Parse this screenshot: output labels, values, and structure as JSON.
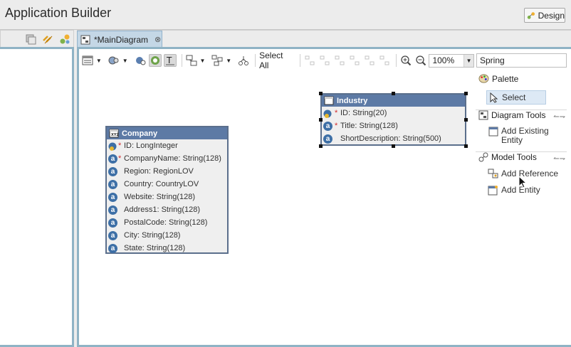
{
  "app": {
    "title": "Application Builder"
  },
  "header": {
    "design_label": "Design"
  },
  "tabs": [
    {
      "label": "*MainDiagram",
      "close_icon": "close-icon"
    }
  ],
  "toolbar": {
    "select_all_label": "Select All",
    "zoom_value": "100%",
    "profile_value": "Spring"
  },
  "palette": {
    "title": "Palette",
    "select_label": "Select",
    "sections": [
      {
        "title": "Diagram Tools",
        "items": [
          {
            "label": "Add Existing Entity",
            "label_line1": "Add Existing",
            "label_line2": "Entity"
          }
        ]
      },
      {
        "title": "Model Tools",
        "items": [
          {
            "label": "Add Reference"
          },
          {
            "label": "Add Entity"
          }
        ]
      }
    ]
  },
  "entities": {
    "industry": {
      "name": "Industry",
      "attributes": [
        {
          "text": "ID: String(20)",
          "required": true,
          "key": true
        },
        {
          "text": "Title: String(128)",
          "required": true,
          "key": false
        },
        {
          "text": "ShortDescription: String(500)",
          "required": false,
          "key": false
        }
      ]
    },
    "company": {
      "name": "Company",
      "attributes": [
        {
          "text": "ID: LongInteger",
          "required": true,
          "key": true
        },
        {
          "text": "CompanyName: String(128)",
          "required": true,
          "key": false
        },
        {
          "text": "Region: RegionLOV",
          "required": false,
          "key": false
        },
        {
          "text": "Country: CountryLOV",
          "required": false,
          "key": false
        },
        {
          "text": "Website: String(128)",
          "required": false,
          "key": false
        },
        {
          "text": "Address1: String(128)",
          "required": false,
          "key": false
        },
        {
          "text": "PostalCode: String(128)",
          "required": false,
          "key": false
        },
        {
          "text": "City: String(128)",
          "required": false,
          "key": false
        },
        {
          "text": "State: String(128)",
          "required": false,
          "key": false
        }
      ]
    }
  },
  "markers": {
    "required_symbol": "*",
    "attribute_glyph": "a"
  }
}
